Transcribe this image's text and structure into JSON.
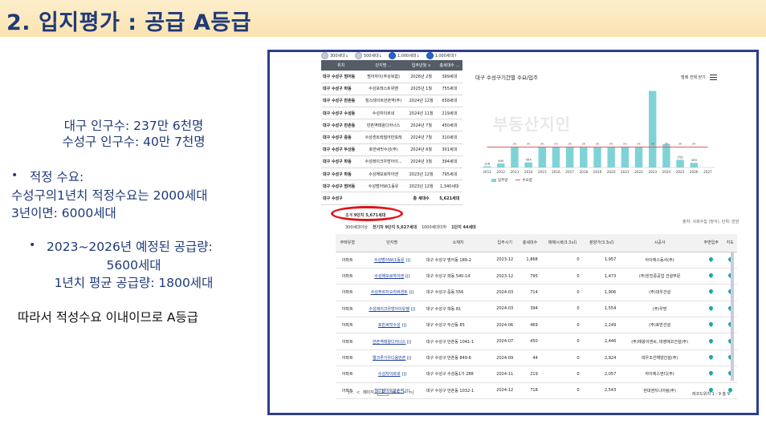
{
  "slide": {
    "title": "2. 입지평가 : 공급 A등급",
    "pop_total": "대구 인구수: 237만 6천명",
    "pop_suseong": "수성구 인구수: 40만 7천명",
    "bullet_1_title": "적정 수요:",
    "bullet_1_line1": "수성구의1년치 적정수요는 2000세대",
    "bullet_1_line2": "3년이면: 6000세대",
    "bullet_2_title": "2023~2026년 예정된 공급량:",
    "bullet_2_line1": "5600세대",
    "bullet_2_line2": "1년치 평균 공급량: 1800세대",
    "conclusion": "따라서 적성수요 이내이므로 A등급",
    "bullet_glyph": "•"
  },
  "pills": [
    "300세대↓",
    "500세대↓",
    "1,000세대↓",
    "1,000세대↑"
  ],
  "supply_table": {
    "headers": [
      "위치",
      "단지명 ...",
      "입주년월 ∨",
      "총세대수 ..."
    ],
    "rows": [
      [
        "대구 수성구 범어동",
        "범어자이(주상복합)",
        "2026년 2월",
        "399세대"
      ],
      [
        "대구 수성구 파동",
        "수성포레스트위벤",
        "2025년 1월",
        "755세대"
      ],
      [
        "대구 수성구 만촌동",
        "힐스테이트만촌역(주)",
        "2024년 12월",
        "658세대"
      ],
      [
        "대구 수성구 수성동",
        "수성자이르네",
        "2024년 11월",
        "219세대"
      ],
      [
        "대구 수성구 만촌동",
        "만촌역태왕디아너스",
        "2024년 7월",
        "450세대"
      ],
      [
        "대구 수성구 중동",
        "수성센트레빌어반포레",
        "2024년 7월",
        "310세대"
      ],
      [
        "대구 수성구 두산동",
        "호반써밋수성(주)",
        "2024년 6월",
        "301세대"
      ],
      [
        "대구 수성구 파동",
        "수성레이크우방아이...",
        "2024년 3월",
        "394세대"
      ],
      [
        "대구 수성구 파동",
        "수성해모로하이엔",
        "2023년 12월",
        "795세대"
      ],
      [
        "대구 수성구 범어동",
        "수성범어W(1동유",
        "2023년 12월",
        "1,340세대"
      ]
    ],
    "total": [
      "대구 수성구",
      "",
      "총 세대수",
      "5,621세대"
    ]
  },
  "chart_panel": {
    "title": "대구 수성구기간별 수요/입주",
    "control": "범례 전체 닫기",
    "watermark": "부동산지인"
  },
  "chart_data": {
    "type": "bar",
    "categories": [
      "2011",
      "2012",
      "2013",
      "2014",
      "2015",
      "2016",
      "2017",
      "2018",
      "2019",
      "2020",
      "2021",
      "2022",
      "2023",
      "2024",
      "2025",
      "2026",
      "2027"
    ],
    "series": [
      {
        "name": "입주량",
        "values": [
          116,
          400,
          2000,
          504,
          2000,
          2000,
          2000,
          2000,
          2000,
          2000,
          2000,
          2000,
          7500,
          2300,
          755,
          455,
          0
        ],
        "color": "#7fd3d6"
      },
      {
        "name": "수요량",
        "values": [
          2000,
          2000,
          2000,
          2000,
          2000,
          2000,
          2000,
          2000,
          2000,
          2000,
          2000,
          2000,
          2000,
          2000,
          2000,
          2000,
          2000
        ],
        "color": "#e05a5a"
      }
    ],
    "bar_labels": [
      "116",
      "400",
      "2k",
      "504",
      "2k",
      "2k",
      "2k",
      "2k",
      "2k",
      "2k",
      "2k",
      "2k",
      "2k",
      "2k",
      "755",
      "455",
      ""
    ],
    "line_labels": [
      "",
      "",
      "2k",
      "2k",
      "2k",
      "2k",
      "2k",
      "2k",
      "2k",
      "2k",
      "2k",
      "2k",
      "2k",
      "2k",
      "2k",
      "2k",
      ""
    ],
    "ylim": [
      0,
      8000
    ]
  },
  "summary": {
    "count_label": "총계",
    "count": "9단지 5,671세대",
    "oval_color": "#e0121b"
  },
  "tabs": [
    "300세대이상",
    "전기차 9단지 5,627세대",
    "1000세대이하",
    "1단지 44세대"
  ],
  "source_note": "출처: 사회수집 (정식), 단위: 만원",
  "list_table": {
    "headers": [
      "주택유형",
      "단지명",
      "소재지",
      "입주시기",
      "총세대수",
      "매매시세(3.3㎡)",
      "분양가(3.3㎡)",
      "시공사",
      "주변입주",
      "지도"
    ],
    "rows": [
      [
        "아파트",
        "수성범어W(1동유",
        "대구 수성구 범어동 189-2",
        "2023-12",
        "1,868",
        "0",
        "1,957",
        "아이에스동서(주)"
      ],
      [
        "아파트",
        "수성해모로하이엔",
        "대구 수성구 파동 540-14",
        "2023-12",
        "795",
        "0",
        "1,473",
        "(주)한진중공업 건설부문"
      ],
      [
        "아파트",
        "수성푸르지오리버센트",
        "대구 수성구 중동 556",
        "2024-03",
        "714",
        "0",
        "1,906",
        "(주)대우건설"
      ],
      [
        "아파트",
        "수성레이크우방아이유쉘",
        "대구 수성구 파동 81",
        "2024-03",
        "394",
        "0",
        "1,554",
        "(주)우방"
      ],
      [
        "아파트",
        "호반써밋수성",
        "대구 수성구 두산동 85",
        "2024-06",
        "469",
        "0",
        "2,249",
        "(주)호반건설"
      ],
      [
        "아파트",
        "만촌역태왕디아너스",
        "대구 수성구 만촌동 1041-1",
        "2024-07",
        "450",
        "0",
        "2,446",
        "(주)태왕이앤씨, 대영에코건설(주)"
      ],
      [
        "아파트",
        "엘크루가우디움만촌",
        "대구 수성구 만촌동 849-6",
        "2024-09",
        "44",
        "0",
        "2,924",
        "대우조선해양건설(주)"
      ],
      [
        "아파트",
        "수성자이르네",
        "대구 수성구 수성동1가 288",
        "2024-11",
        "219",
        "0",
        "2,057",
        "자이에스앤디(주)"
      ],
      [
        "아파트",
        "힐스테이트만촌역",
        "대구 수성구 만촌동 1032-1",
        "2024-12",
        "718",
        "0",
        "2,543",
        "현대엔지니어링(주)"
      ]
    ]
  },
  "pager": {
    "first": "|<",
    "prev": "<",
    "label": "페이지",
    "current": "1",
    "of": "of 1",
    "next": ">",
    "last": ">|",
    "range": "레코드위치 1 - 9 총 9"
  }
}
